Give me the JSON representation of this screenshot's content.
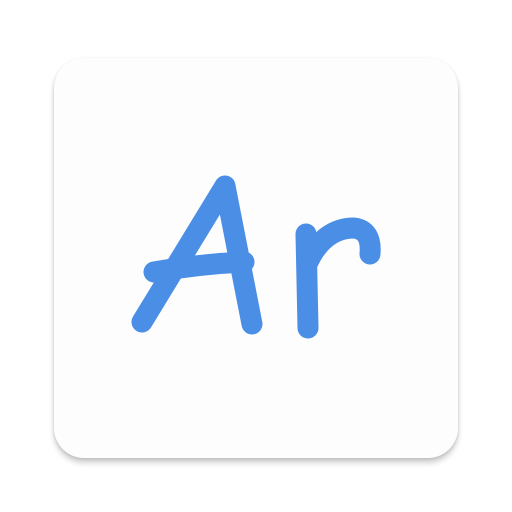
{
  "app_icon": {
    "logo_text": "Ar",
    "glyph_color": "#4a8ee6",
    "tile_color": "#fdfdfd"
  }
}
